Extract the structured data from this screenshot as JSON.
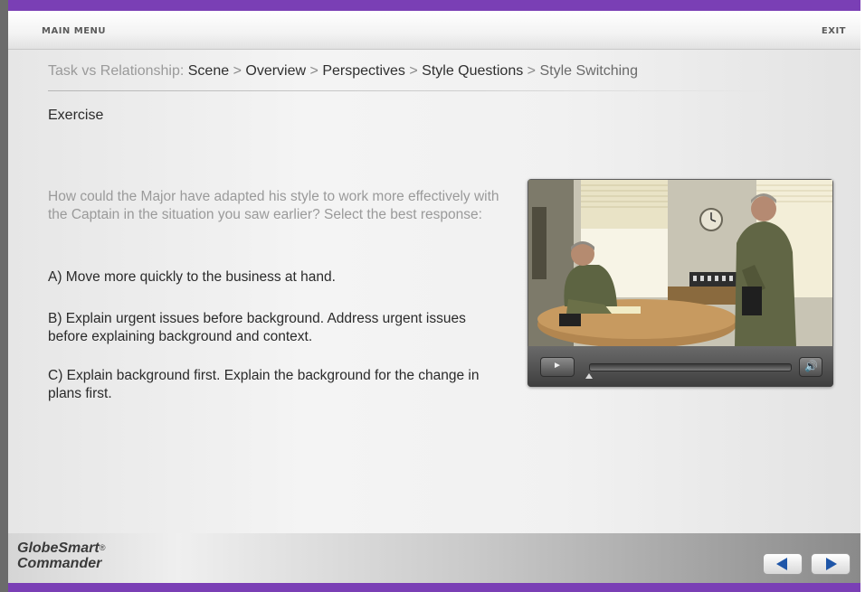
{
  "menu": {
    "main_menu": "MAIN MENU",
    "exit": "EXIT"
  },
  "breadcrumb": {
    "prefix": "Task vs Relationship:",
    "items": [
      "Scene",
      "Overview",
      "Perspectives",
      "Style Questions"
    ],
    "current": "Style Switching",
    "separator": ">"
  },
  "section_title": "Exercise",
  "question": "How could the Major have adapted his style to work more effectively with the Captain in the situation you saw earlier? Select the best response:",
  "answers": [
    "A) Move more quickly to the business at hand.",
    "B) Explain urgent issues before background. Address urgent issues before explaining background and context.",
    "C) Explain background first. Explain the background for the change in plans first."
  ],
  "player": {
    "progress": 0.0,
    "play_icon": "play-icon",
    "volume_icon": "volume-icon"
  },
  "footer": {
    "logo_line1": "GlobeSmart",
    "logo_reg": "®",
    "logo_line2": "Commander",
    "prev_icon": "arrow-left-icon",
    "next_icon": "arrow-right-icon"
  },
  "colors": {
    "accent": "#7a3fb5",
    "nav_arrow": "#1f56a8"
  }
}
